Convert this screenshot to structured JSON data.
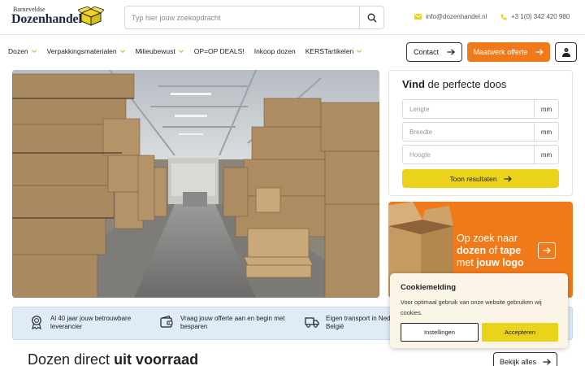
{
  "header": {
    "logo_small": "Barneveldse",
    "logo_big": "Dozenhandel",
    "search_placeholder": "Typ hier jouw zoekopdracht",
    "email": "info@dozenhandel.nl",
    "phone": "+3 1(0) 342 420 980"
  },
  "nav": {
    "items": [
      {
        "label": "Dozen",
        "has_dropdown": true
      },
      {
        "label": "Verpakkingsmaterialen",
        "has_dropdown": true
      },
      {
        "label": "Milieubewust",
        "has_dropdown": true
      },
      {
        "label": "OP=OP DEALS!",
        "has_dropdown": false
      },
      {
        "label": "Inkoop dozen",
        "has_dropdown": false
      },
      {
        "label": "KERSTartikelen",
        "has_dropdown": true
      }
    ],
    "contact_label": "Contact",
    "offerte_label": "Maatwerk offerte"
  },
  "finder": {
    "title_bold": "Vind",
    "title_rest": " de perfecte doos",
    "fields": [
      {
        "placeholder": "Lengte",
        "unit": "mm"
      },
      {
        "placeholder": "Breedte",
        "unit": "mm"
      },
      {
        "placeholder": "Hoogte",
        "unit": "mm"
      }
    ],
    "button_label": "Toon resultaten"
  },
  "promo": {
    "line1": "Op zoek naar",
    "line2_bold1": "dozen",
    "line2_mid": " of ",
    "line2_bold2": "tape",
    "line3_pre": "met ",
    "line3_bold": "jouw logo"
  },
  "usps": [
    {
      "icon": "award-icon",
      "line1": "Al 40 jaar jouw betrouwbare",
      "line2": "leverancier"
    },
    {
      "icon": "wallet-icon",
      "line1": "Vraag jouw offerte aan en begin met",
      "line2": "besparen"
    },
    {
      "icon": "truck-icon",
      "line1": "Eigen transport in Ned",
      "line2": "België"
    }
  ],
  "section": {
    "title_regular": "Dozen direct ",
    "title_bold": "uit voorraad",
    "view_all_label": "Bekijk alles"
  },
  "cookie": {
    "title": "Cookiemelding",
    "text": "Voor optimaal gebruik van onze website gebruiken wij cookies.",
    "settings_label": "Instellingen",
    "accept_label": "Accepteren"
  },
  "colors": {
    "accent_orange": "#f07a1a",
    "accent_yellow": "#ead31a",
    "usp_background": "#dfecf8"
  }
}
